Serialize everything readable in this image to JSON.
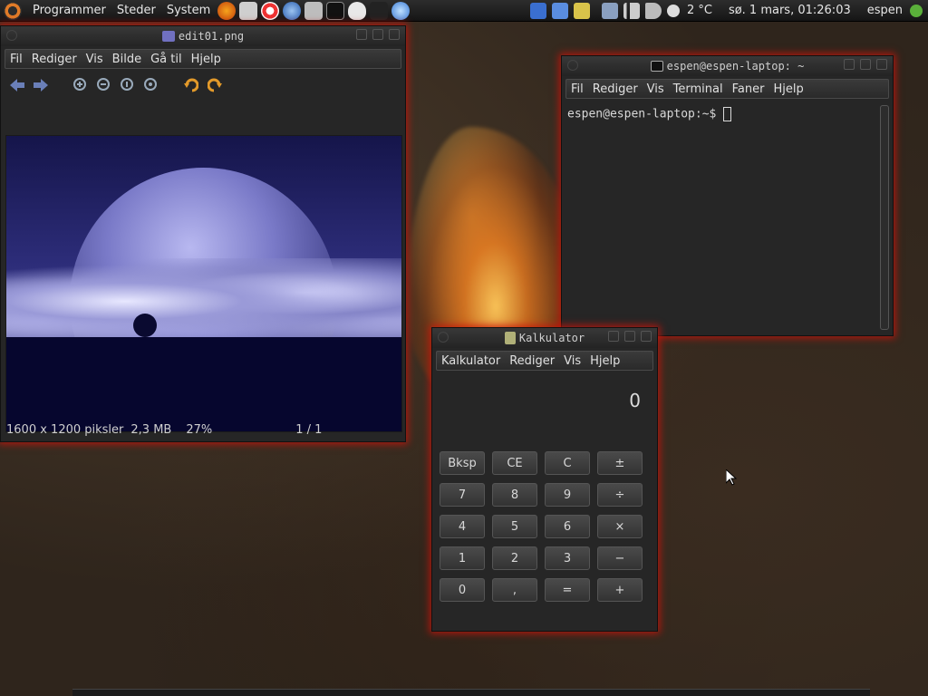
{
  "panel": {
    "menus": [
      "Programmer",
      "Steder",
      "System"
    ],
    "temperature": "2 °C",
    "datetime": "sø.  1 mars, 01:26:03",
    "user": "espen"
  },
  "viewer": {
    "title": "edit01.png",
    "menu": [
      "Fil",
      "Rediger",
      "Vis",
      "Bilde",
      "Gå til",
      "Hjelp"
    ],
    "status": {
      "dims": "1600 x 1200 piksler",
      "size": "2,3 MB",
      "zoom": "27%",
      "page": "1 / 1"
    }
  },
  "terminal": {
    "title": "espen@espen-laptop: ~",
    "menu": [
      "Fil",
      "Rediger",
      "Vis",
      "Terminal",
      "Faner",
      "Hjelp"
    ],
    "prompt": "espen@espen-laptop:~$"
  },
  "calc": {
    "title": "Kalkulator",
    "menu": [
      "Kalkulator",
      "Rediger",
      "Vis",
      "Hjelp"
    ],
    "display": "0",
    "keys": [
      "Bksp",
      "CE",
      "C",
      "±",
      "7",
      "8",
      "9",
      "÷",
      "4",
      "5",
      "6",
      "×",
      "1",
      "2",
      "3",
      "−",
      "0",
      ",",
      "=",
      "+"
    ]
  },
  "colors": {
    "glow": "#c8140a",
    "accent": "#e07b28"
  }
}
